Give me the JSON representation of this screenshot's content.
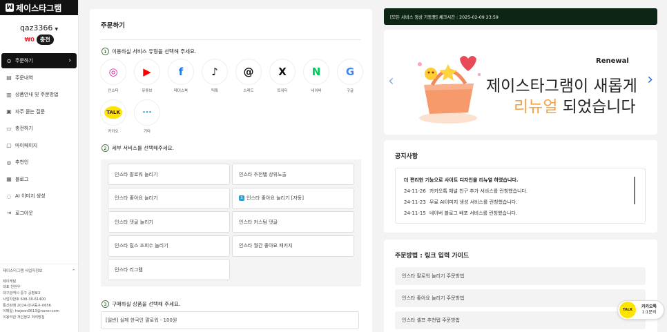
{
  "sidebar": {
    "logo": "제이스타그램",
    "username": "qaz3366",
    "balance": "₩0",
    "charge_label": "충전",
    "menu": [
      {
        "label": "주문하기",
        "icon": "cart-icon"
      },
      {
        "label": "주문내역",
        "icon": "document-icon"
      },
      {
        "label": "상품안내 및 주문방법",
        "icon": "book-icon"
      },
      {
        "label": "자주 묻는 질문",
        "icon": "chat-icon"
      },
      {
        "label": "충전하기",
        "icon": "card-icon"
      },
      {
        "label": "마이페이지",
        "icon": "folder-icon"
      },
      {
        "label": "추천인",
        "icon": "user-icon"
      },
      {
        "label": "블로그",
        "icon": "list-icon"
      },
      {
        "label": "AI 이미지 생성",
        "icon": "ai-icon"
      },
      {
        "label": "로그아웃",
        "icon": "logout-icon"
      }
    ],
    "business": {
      "title": "제이스타그램 사업자정보",
      "lines": [
        "제이케팅",
        "대표 천현우",
        "대구광역시 중구 공평로3",
        "사업자번호 608-30-61400",
        "통신판매 2024-대구중구-0656",
        "이메일: hwjeon0613@naver.com",
        "이용약관  개인정보 처리방침"
      ]
    }
  },
  "order": {
    "title": "주문하기",
    "step1": {
      "num": "1",
      "label": "이용하실 서비스 유형을 선택해 주세요."
    },
    "step2": {
      "num": "2",
      "label": "세부 서비스를 선택해주세요."
    },
    "step3": {
      "num": "3",
      "label": "구매하실 상품을 선택해 주세요."
    },
    "services": [
      {
        "label": "인스타",
        "icon": "instagram-icon",
        "glyph": "◎",
        "color": "#d6249f"
      },
      {
        "label": "유튜브",
        "icon": "youtube-icon",
        "glyph": "▶",
        "color": "#ff0000"
      },
      {
        "label": "페이스북",
        "icon": "facebook-icon",
        "glyph": "f",
        "color": "#1877f2"
      },
      {
        "label": "틱톡",
        "icon": "tiktok-icon",
        "glyph": "♪",
        "color": "#111111"
      },
      {
        "label": "스레드",
        "icon": "threads-icon",
        "glyph": "@",
        "color": "#111111"
      },
      {
        "label": "트위터",
        "icon": "x-icon",
        "glyph": "X",
        "color": "#111111"
      },
      {
        "label": "네이버",
        "icon": "naver-icon",
        "glyph": "N",
        "color": "#03c75a"
      },
      {
        "label": "구글",
        "icon": "google-icon",
        "glyph": "G",
        "color": "#4285f4"
      },
      {
        "label": "카카오",
        "icon": "kakao-icon",
        "glyph": "TALK",
        "color": "#3a1d1d"
      },
      {
        "label": "기타",
        "icon": "more-icon",
        "glyph": "•••",
        "color": "#2a9fd6"
      }
    ],
    "details": [
      {
        "label": "인스타 팔로워 늘리기",
        "tag": ""
      },
      {
        "label": "인스타 추천탭 상위노출",
        "tag": ""
      },
      {
        "label": "인스타 좋아요 늘리기",
        "tag": ""
      },
      {
        "label": "인스타 좋아요 늘리기 [자동]",
        "tag": "S"
      },
      {
        "label": "인스타 댓글 늘리기",
        "tag": ""
      },
      {
        "label": "인스타 커스텀 댓글",
        "tag": ""
      },
      {
        "label": "인스타 릴스 조회수 늘리기",
        "tag": ""
      },
      {
        "label": "인스타 월간 좋아요 패키지",
        "tag": ""
      },
      {
        "label": "인스타 리그램",
        "tag": ""
      }
    ],
    "product_selected": "[일반] 실제 한국인 팔로워 - 100원"
  },
  "status_bar": "[모든 서비스 정상 가동중] 체크시간 : 2025-02-09 23:59",
  "banner": {
    "eyebrow": "Renewal",
    "line1": "제이스타그램이 새롭게",
    "line2_highlight": "리뉴얼",
    "line2_rest": " 되었습니다",
    "accent": "#f5a142"
  },
  "notice": {
    "title": "공지사항",
    "headline": "더 편리한 기능으로 사이트 디자인을 리뉴얼 하였습니다.",
    "items": [
      {
        "date": "24-11-26",
        "text": "카카오톡 채널 친구 추가 서비스를 런칭했습니다."
      },
      {
        "date": "24-11-23",
        "text": "무료 AI이미지 생성 서비스를 런칭했습니다."
      },
      {
        "date": "24-11-15",
        "text": "네이버 블로그 배포 서비스를 런칭했습니다."
      }
    ]
  },
  "guide": {
    "title": "주문방법 : 링크 입력 가이드",
    "items": [
      "인스타 팔로워 늘리기 주문방법",
      "인스타 좋아요 늘리기 주문방법",
      "인스타 셀프 추천탭 주문방법"
    ]
  },
  "kakao_float": {
    "bubble": "TALK",
    "line1": "카카오톡",
    "line2": "1:1문의"
  }
}
